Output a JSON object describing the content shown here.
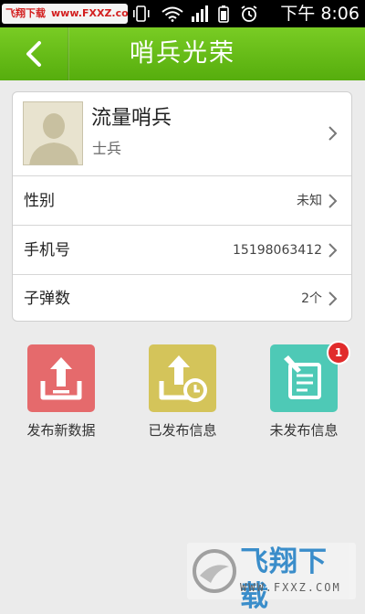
{
  "status_bar": {
    "watermark_cn": "飞翔下载",
    "watermark_url": "www.FXXZ.com",
    "time": "下午 8:06"
  },
  "header": {
    "title": "哨兵光荣",
    "back_icon": "chevron-left-icon"
  },
  "profile": {
    "name": "流量哨兵",
    "rank": "士兵",
    "avatar_icon": "avatar-placeholder"
  },
  "info_rows": [
    {
      "label": "性别",
      "value": "未知"
    },
    {
      "label": "手机号",
      "value": "15198063412"
    },
    {
      "label": "子弹数",
      "value": "2个"
    }
  ],
  "actions": [
    {
      "label": "发布新数据",
      "icon": "upload-tray-icon",
      "color": "#e56a6c"
    },
    {
      "label": "已发布信息",
      "icon": "published-clock-icon",
      "color": "#d4c45a"
    },
    {
      "label": "未发布信息",
      "icon": "draft-edit-icon",
      "color": "#4ec9b6",
      "badge": "1"
    }
  ],
  "watermark_logo": {
    "text": "飞翔下载",
    "url": "WWW.FXXZ.COM"
  },
  "colors": {
    "header_green": "#66bb16",
    "background": "#ebebeb"
  }
}
